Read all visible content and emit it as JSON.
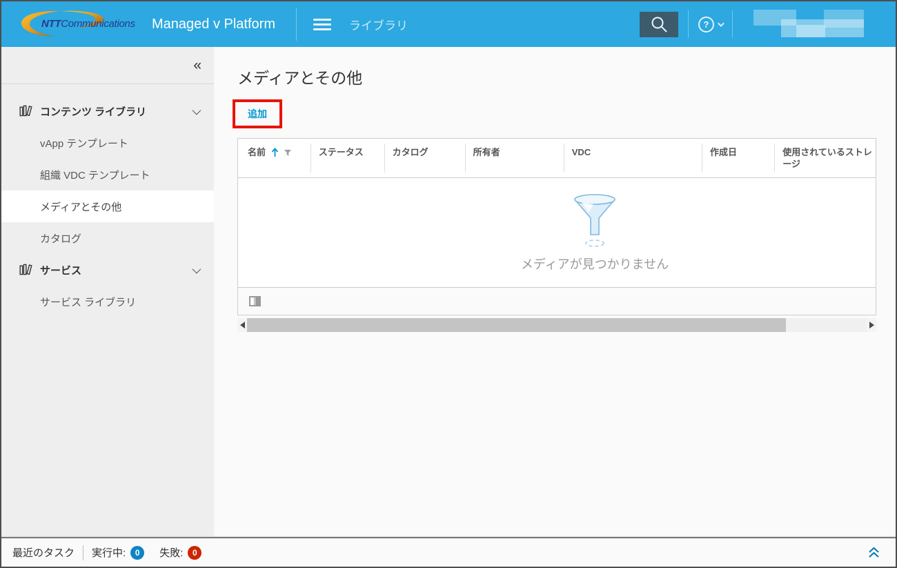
{
  "header": {
    "logo_bold": "NTT",
    "logo_rest": "Communications",
    "app_title": "Managed v Platform",
    "tab_label": "ライブラリ"
  },
  "sidebar": {
    "collapse_icon": "«",
    "items": [
      {
        "label": "コンテンツ ライブラリ"
      },
      {
        "label": "vApp テンプレート"
      },
      {
        "label": "組織 VDC テンプレート"
      },
      {
        "label": "メディアとその他"
      },
      {
        "label": "カタログ"
      },
      {
        "label": "サービス"
      },
      {
        "label": "サービス ライブラリ"
      }
    ]
  },
  "main": {
    "page_title": "メディアとその他",
    "add_button_label": "追加",
    "table": {
      "columns": [
        "名前",
        "ステータス",
        "カタログ",
        "所有者",
        "VDC",
        "作成日",
        "使用されているストレージ"
      ],
      "empty_message": "メディアが見つかりません"
    }
  },
  "taskbar": {
    "recent_tasks_label": "最近のタスク",
    "running_label": "実行中:",
    "running_count": "0",
    "failed_label": "失敗:",
    "failed_count": "0"
  },
  "colors": {
    "header_blue": "#2da8e0",
    "accent_blue": "#0095d3",
    "running_badge": "#0e84c6",
    "failed_badge": "#cc2500",
    "annotation_red": "#e8140c"
  }
}
